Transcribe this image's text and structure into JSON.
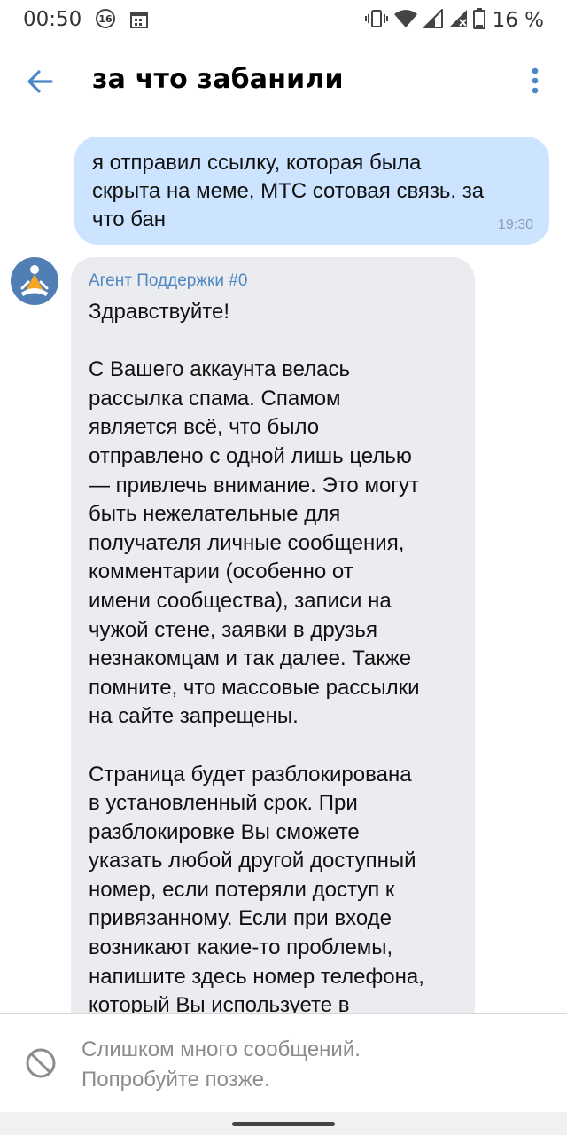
{
  "status_bar": {
    "time": "00:50",
    "notification_badge": "16",
    "battery_percent": "16 %",
    "icons": [
      "calendar-icon",
      "vibrate-icon",
      "wifi-icon",
      "signal-icon",
      "signal-x-icon",
      "battery-icon"
    ]
  },
  "header": {
    "title": "за что забанили",
    "back_icon": "arrow-left-icon",
    "menu_icon": "more-vertical-icon"
  },
  "messages": {
    "outgoing": {
      "text": "я отправил ссылку, которая была\nскрыта на меме, МТС сотовая связь. за\nчто бан",
      "time": "19:30"
    },
    "incoming": {
      "author": "Агент Поддержки #0",
      "text": "Здравствуйте!\n\nС Вашего аккаунта велась\nрассылка спама. Спамом\nявляется всё, что было\nотправлено с одной лишь целью\n— привлечь внимание. Это могут\nбыть нежелательные для\nполучателя личные сообщения,\nкомментарии (особенно от\nимени сообщества), записи на\nчужой стене, заявки в друзья\nнезнакомцам и так далее. Также\nпомните, что массовые рассылки\nна сайте запрещены.\n\nСтраница будет разблокирована\nв установленный срок. При\nразблокировке Вы сможете\nуказать любой другой доступный\nномер, если потеряли доступ к\nпривязанному. Если при входе\nвозникают какие-то проблемы,\nнапишите здесь номер телефона,\nкоторый Вы используете в"
    }
  },
  "bottom_bar": {
    "line1": "Слишком много сообщений.",
    "line2": "Попробуйте позже.",
    "icon": "blocked-icon"
  },
  "colors": {
    "accent": "#4a86c8",
    "outgoing_bubble": "#cce4ff",
    "incoming_bubble": "#ebecf0",
    "author_name": "#4f87c0",
    "muted_text": "#8c8c8c",
    "avatar_bg": "#4f7fb5",
    "avatar_figure": "#f5a623"
  }
}
